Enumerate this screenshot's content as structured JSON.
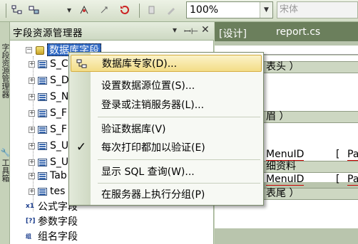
{
  "toolbar": {
    "zoom": "100%",
    "font": "宋体"
  },
  "vertical_tabs": [
    "字段资源管理器",
    "工具箱"
  ],
  "panel": {
    "title": "字段资源管理器",
    "pin_icon": "pin-icon",
    "close_icon": "close-icon",
    "root_label": "数据库字段",
    "tables": [
      "S_C",
      "S_D",
      "S_N",
      "S_F",
      "S_F",
      "S_U",
      "S_U",
      "Tab",
      "tes"
    ],
    "extra_items": [
      {
        "label": "公式字段",
        "icon": "x1"
      },
      {
        "label": "参数字段",
        "icon": "[?]"
      },
      {
        "label": "组名字段",
        "icon": "组"
      }
    ]
  },
  "doc_tabs": [
    "[设计]",
    "report.cs"
  ],
  "designer": {
    "bands": [
      "表头 ）",
      "眉 ）",
      "细资料",
      "表尾 ）"
    ],
    "fields_row1": [
      "MenuID",
      "Pa"
    ],
    "fields_row2": [
      "MenuID",
      "Pa"
    ]
  },
  "context_menu": {
    "items": [
      {
        "label": "数据库专家(D)...",
        "icon": "db-expert-icon",
        "highlighted": true
      },
      {
        "label": "设置数据源位置(S)...",
        "icon": "",
        "highlighted": false
      },
      {
        "label": "登录或注销服务器(L)...",
        "icon": "",
        "highlighted": false
      },
      {
        "label": "验证数据库(V)",
        "icon": "",
        "highlighted": false
      },
      {
        "label": "每次打印都加以验证(E)",
        "icon": "checkmark-icon",
        "highlighted": false
      },
      {
        "label": "显示 SQL 查询(W)...",
        "icon": "",
        "highlighted": false
      },
      {
        "label": "在服务器上执行分组(P)",
        "icon": "",
        "highlighted": false
      }
    ]
  }
}
